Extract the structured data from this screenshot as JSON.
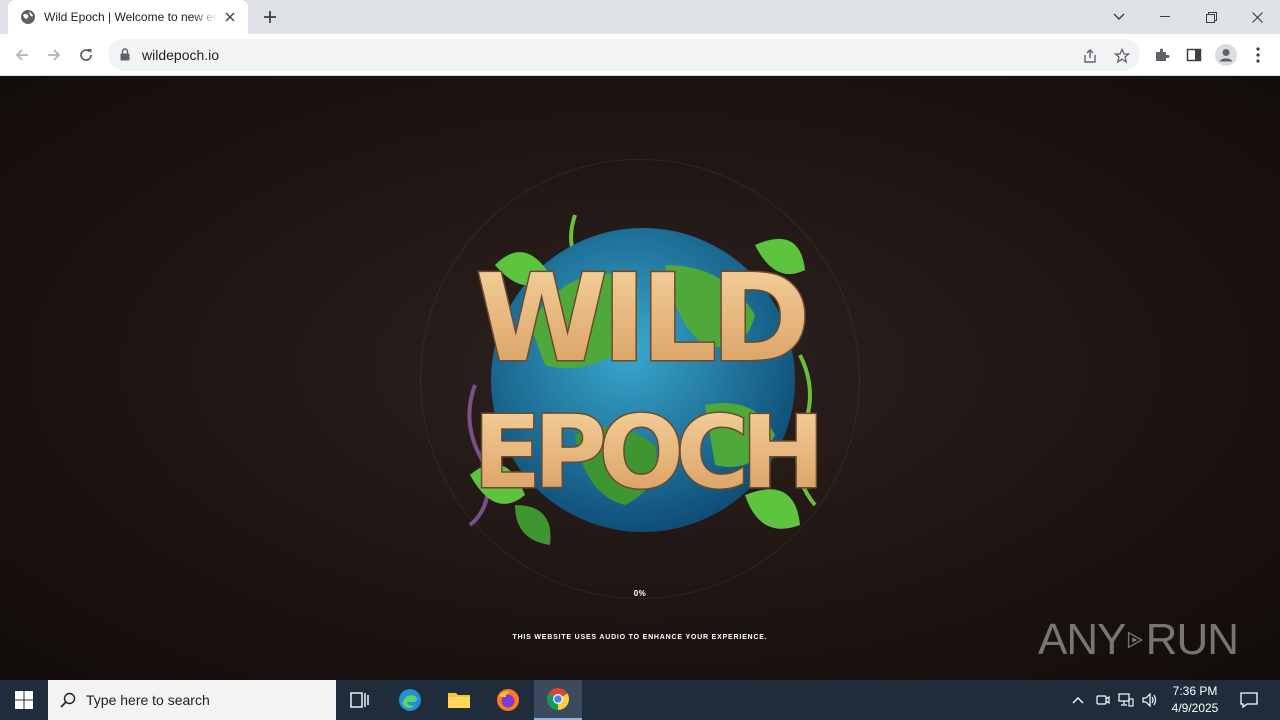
{
  "browser": {
    "tab_title": "Wild Epoch | Welcome to new era of gaming",
    "url": "wildepoch.io",
    "new_tab_label": "+"
  },
  "page": {
    "logo_alt": "WILD EPOCH",
    "logo_line1": "WILD",
    "logo_line2": "EPOCH",
    "progress_text": "0%",
    "progress_value": 0,
    "audio_notice": "THIS WEBSITE USES AUDIO TO ENHANCE YOUR EXPERIENCE."
  },
  "watermark": {
    "text_left": "ANY",
    "text_right": "RUN"
  },
  "taskbar": {
    "search_placeholder": "Type here to search",
    "time": "7:36 PM",
    "date": "4/9/2025"
  },
  "colors": {
    "page_bg": "#1a1210",
    "logo_rock": "#e8b27a",
    "globe_ocean": "#1e7fa6",
    "globe_land": "#4fa83a",
    "taskbar_bg": "#1f2c3c"
  }
}
